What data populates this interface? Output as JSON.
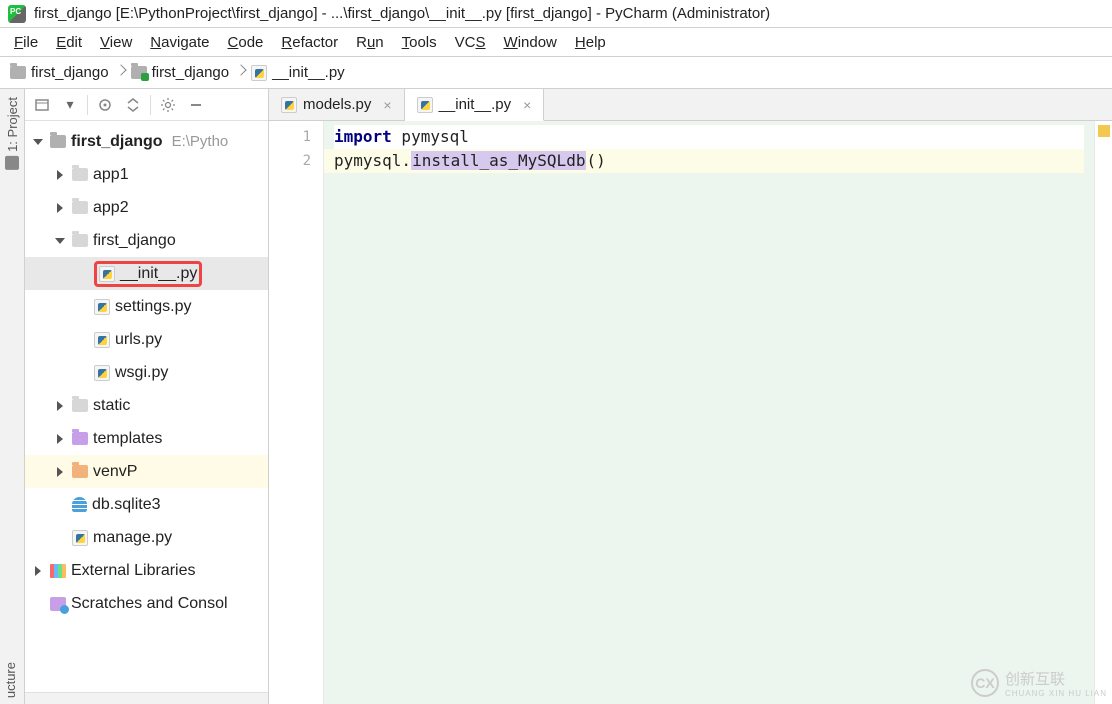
{
  "title": "first_django [E:\\PythonProject\\first_django] - ...\\first_django\\__init__.py [first_django] - PyCharm (Administrator)",
  "menu": [
    "File",
    "Edit",
    "View",
    "Navigate",
    "Code",
    "Refactor",
    "Run",
    "Tools",
    "VCS",
    "Window",
    "Help"
  ],
  "breadcrumb": [
    {
      "icon": "folder",
      "label": "first_django"
    },
    {
      "icon": "folder-django",
      "label": "first_django"
    },
    {
      "icon": "py",
      "label": "__init__.py"
    }
  ],
  "tool_strip": {
    "project": "1: Project",
    "structure": "ucture"
  },
  "tree": {
    "root": {
      "label": "first_django",
      "hint": "E:\\Pytho"
    },
    "app1": "app1",
    "app2": "app2",
    "first_django": "first_django",
    "init": "__init__.py",
    "settings": "settings.py",
    "urls": "urls.py",
    "wsgi": "wsgi.py",
    "static": "static",
    "templates": "templates",
    "venv": "venvP",
    "db": "db.sqlite3",
    "manage": "manage.py",
    "ext": "External Libraries",
    "scratch": "Scratches and Consol"
  },
  "tabs": [
    {
      "label": "models.py",
      "active": false
    },
    {
      "label": "__init__.py",
      "active": true
    }
  ],
  "code": {
    "line1": {
      "kw": "import",
      "rest": " pymysql"
    },
    "line2": {
      "pre": "pymysql.",
      "hl": "install_as_MySQLdb",
      "post": "()"
    }
  },
  "gutter": [
    "1",
    "2"
  ],
  "watermark": {
    "icon": "CX",
    "label": "创新互联",
    "sub": "CHUANG XIN HU LIAN"
  }
}
